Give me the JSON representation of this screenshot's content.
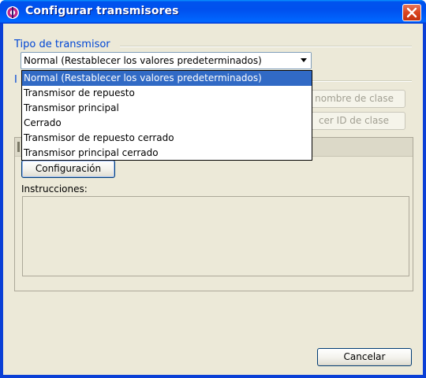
{
  "window": {
    "title": "Configurar transmisores",
    "app_icon": "java-cup-icon",
    "close_icon": "close-icon",
    "accent_color": "#0054e3",
    "close_color": "#d9451f"
  },
  "transmitter_type": {
    "group_title": "Tipo de transmisor",
    "selected": "Normal (Restablecer los valores predeterminados)",
    "options": [
      "Normal (Restablecer los valores predeterminados)",
      "Transmisor de repuesto",
      "Transmisor principal",
      "Cerrado",
      "Transmisor de repuesto cerrado",
      "Transmisor principal cerrado"
    ],
    "highlighted_index": 0,
    "highlight_color": "#316ac5"
  },
  "info_group": {
    "title_visible_fragment": "I"
  },
  "side_buttons": {
    "class_name_label": "nombre de clase",
    "class_id_label": "cer ID de clase"
  },
  "config_panel": {
    "config_button": "Configuración",
    "instructions_label": "Instrucciones:"
  },
  "footer": {
    "cancel_button": "Cancelar"
  }
}
